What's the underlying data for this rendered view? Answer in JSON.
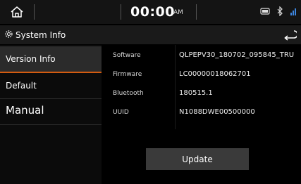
{
  "status_bar": {
    "time": "00:00",
    "ampm": "AM",
    "icons": [
      "home-icon",
      "phone-projection-icon",
      "bluetooth-icon",
      "signal-icon"
    ]
  },
  "header": {
    "icon": "gear-icon",
    "title": "System Info",
    "back_icon": "back-arrow-icon"
  },
  "sidebar": {
    "items": [
      {
        "label": "Version Info",
        "active": true
      },
      {
        "label": "Default",
        "active": false
      },
      {
        "label": "Manual",
        "active": false
      }
    ]
  },
  "info": {
    "rows": [
      {
        "label": "Software",
        "value": "QLPEPV30_180702_095845_TRU"
      },
      {
        "label": "Firmware",
        "value": "LC00000018062701"
      },
      {
        "label": "Bluetooth",
        "value": "180515.1"
      },
      {
        "label": "UUID",
        "value": "N1088DWE00500000"
      }
    ]
  },
  "actions": {
    "update_label": "Update"
  },
  "colors": {
    "accent": "#d35b10",
    "background": "#000000",
    "button": "#3a3a3a"
  }
}
